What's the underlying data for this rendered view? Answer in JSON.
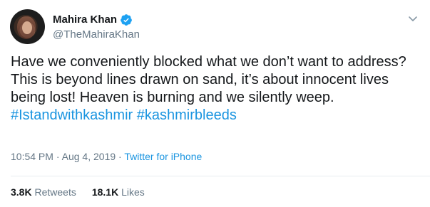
{
  "user": {
    "display_name": "Mahira Khan",
    "handle": "@TheMahiraKhan",
    "verified_icon": "verified-badge-icon",
    "more_icon": "chevron-down-icon"
  },
  "tweet": {
    "text_main": "Have we conveniently blocked what we don’t want to address? This is beyond lines drawn on sand, it’s about innocent lives being lost! Heaven is burning and we silently weep. ",
    "hashtag_1": "#Istandwithkashmir",
    "hashtag_2": "#kashmirbleeds",
    "time": "10:54 PM",
    "date": "Aug 4, 2019",
    "separator": "·",
    "source": "Twitter for iPhone"
  },
  "stats": {
    "retweets_count": "3.8K",
    "retweets_label": "Retweets",
    "likes_count": "18.1K",
    "likes_label": "Likes"
  },
  "colors": {
    "link": "#1b95e0",
    "text": "#14171a",
    "secondary": "#657786",
    "divider": "#e6ecf0"
  }
}
